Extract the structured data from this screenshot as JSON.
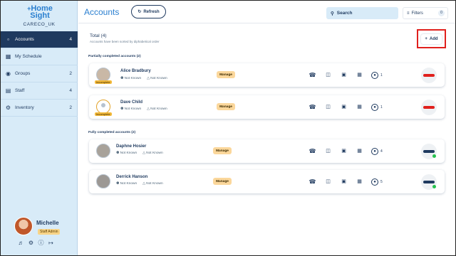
{
  "app": {
    "logo_plus": "+",
    "logo_line1": "Home",
    "logo_line2": "Sight",
    "org": "CARECO_UK"
  },
  "sidebar": {
    "items": [
      {
        "label": "Accounts",
        "count": "4",
        "icon": "accounts-icon"
      },
      {
        "label": "My Schedule",
        "count": "",
        "icon": "calendar-icon"
      },
      {
        "label": "Groups",
        "count": "2",
        "icon": "groups-icon"
      },
      {
        "label": "Staff",
        "count": "4",
        "icon": "staff-icon"
      },
      {
        "label": "Inventory",
        "count": "2",
        "icon": "inventory-icon"
      }
    ]
  },
  "user": {
    "name": "Michelle",
    "role": "Staff Admin"
  },
  "header": {
    "title": "Accounts",
    "refresh_label": "Refresh",
    "search_placeholder": "Search",
    "filters_label": "Filters",
    "filters_count": "0"
  },
  "main": {
    "total": "Total (4)",
    "sort_note": "Accounts have been sorted by diphabetical order",
    "add_label": "Add",
    "partial_heading": "Partially completed accounts (2)",
    "full_heading": "Fully completed accounts (2)",
    "manage_label": "Manage",
    "incomplete_label": "Incomplete",
    "accounts": [
      {
        "name": "Alice Bradbury",
        "gender": "Not Known",
        "status": "Not Known",
        "circle": "1",
        "incomplete": true,
        "device_color": "#e0201d"
      },
      {
        "name": "Dave Child",
        "gender": "Not Known",
        "status": "Not Known",
        "circle": "1",
        "incomplete": true,
        "device_color": "#e0201d"
      },
      {
        "name": "Daphne Hosier",
        "gender": "Not Known",
        "status": "Not Known",
        "circle": "4",
        "incomplete": false,
        "device_color": "#1f3a5f"
      },
      {
        "name": "Derrick Hanson",
        "gender": "Not Known",
        "status": "Not Known",
        "circle": "5",
        "incomplete": false,
        "device_color": "#1f3a5f"
      }
    ]
  },
  "colors": {
    "accent": "#2a7fd0",
    "navy": "#1f3a5f",
    "sidebar_bg": "#d8ebf8",
    "manage_bg": "#fbd79b",
    "highlight_box": "#e0201d",
    "online": "#26c24f"
  }
}
